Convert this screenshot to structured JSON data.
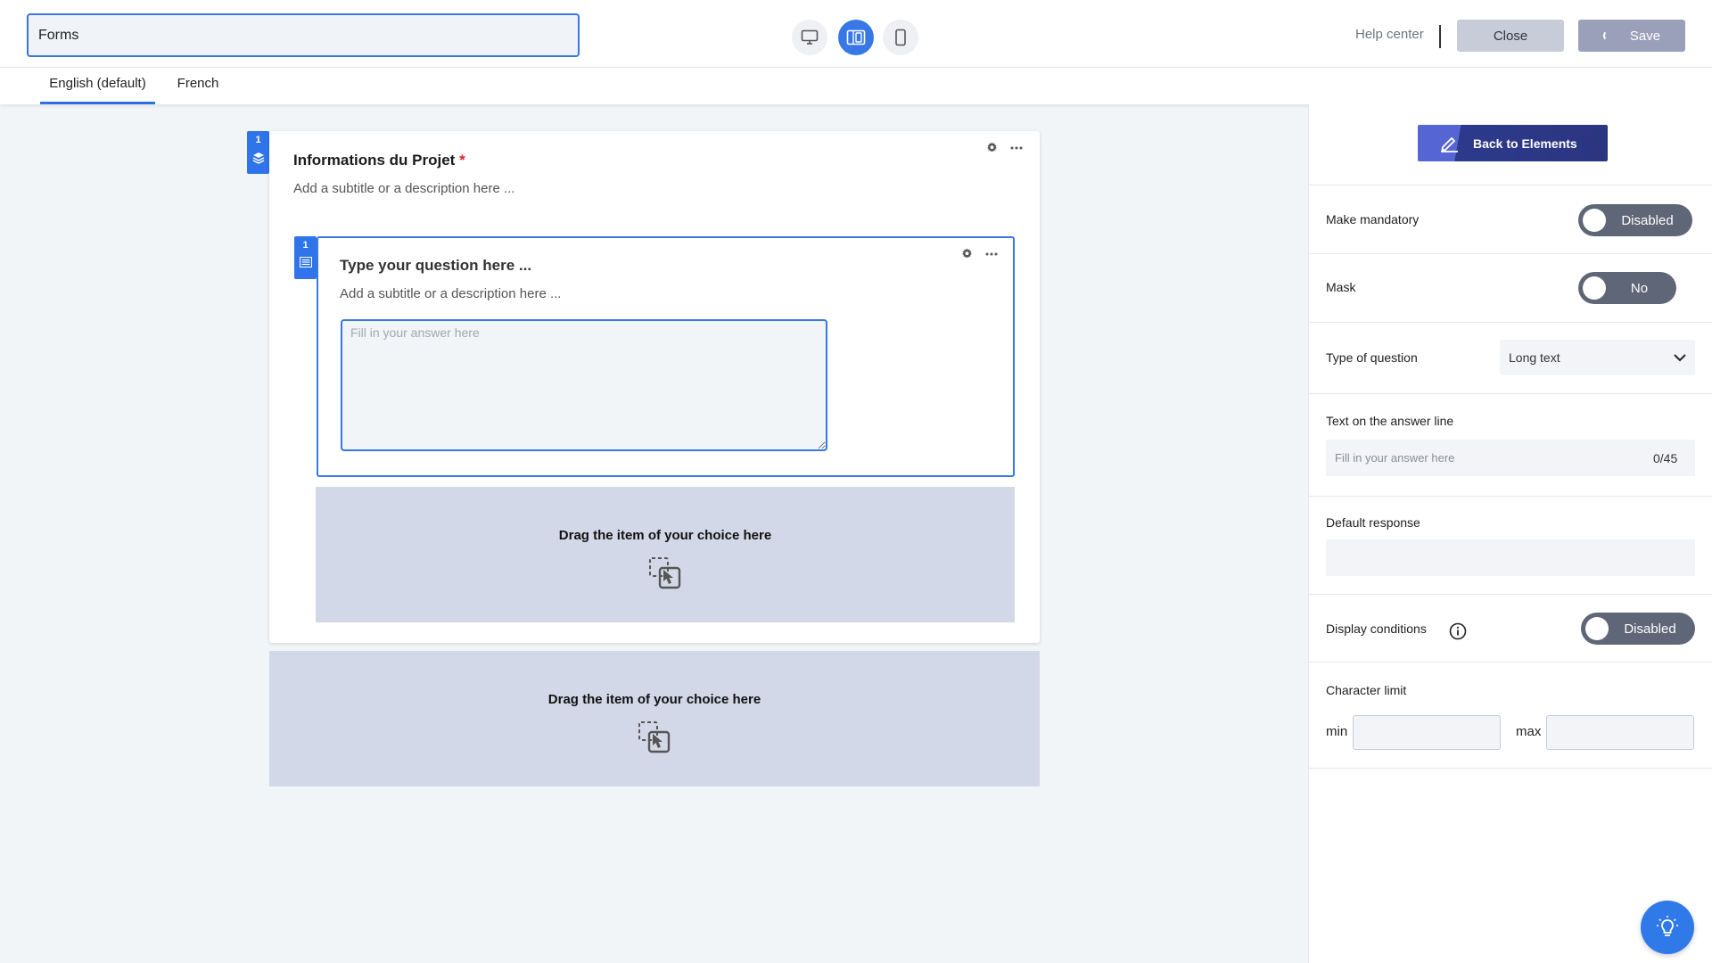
{
  "header": {
    "form_title_value": "Forms",
    "help_label": "Help center",
    "close_label": "Close",
    "save_label": "Save"
  },
  "languages": {
    "tabs": [
      {
        "label": "English (default)",
        "active": true
      },
      {
        "label": "French",
        "active": false
      }
    ]
  },
  "canvas": {
    "section": {
      "number": "1",
      "title": "Informations du Projet",
      "required_mark": "*",
      "subtitle": "Add a subtitle or a description here ..."
    },
    "question": {
      "number": "1",
      "title": "Type your question here ...",
      "subtitle": "Add a subtitle or a description here ...",
      "answer_placeholder": "Fill in your answer here"
    },
    "dropzone_inner_label": "Drag the item of your choice here",
    "dropzone_outer_label": "Drag the item of your choice here"
  },
  "panel": {
    "back_label": "Back to Elements",
    "mandatory": {
      "label": "Make mandatory",
      "state": "Disabled"
    },
    "mask": {
      "label": "Mask",
      "state": "No"
    },
    "type_of_question": {
      "label": "Type of question",
      "value": "Long text"
    },
    "answer_line": {
      "label": "Text on the answer line",
      "placeholder": "Fill in your answer here",
      "counter": "0/45"
    },
    "default_response": {
      "label": "Default response",
      "value": ""
    },
    "display_conditions": {
      "label": "Display conditions",
      "state": "Disabled"
    },
    "character_limit": {
      "label": "Character limit",
      "min_label": "min",
      "max_label": "max",
      "min_value": "",
      "max_value": ""
    }
  },
  "colors": {
    "accent": "#3878e6",
    "toggle_off": "#5f6677",
    "dropzone": "#d3d8e8",
    "required": "#e02424"
  },
  "icons": [
    "desktop-icon",
    "split-view-icon",
    "mobile-icon",
    "layers-icon",
    "long-text-icon",
    "gear-icon",
    "more-icon",
    "drag-drop-icon",
    "edit-icon",
    "info-icon",
    "chevron-down-icon",
    "lightbulb-icon"
  ]
}
